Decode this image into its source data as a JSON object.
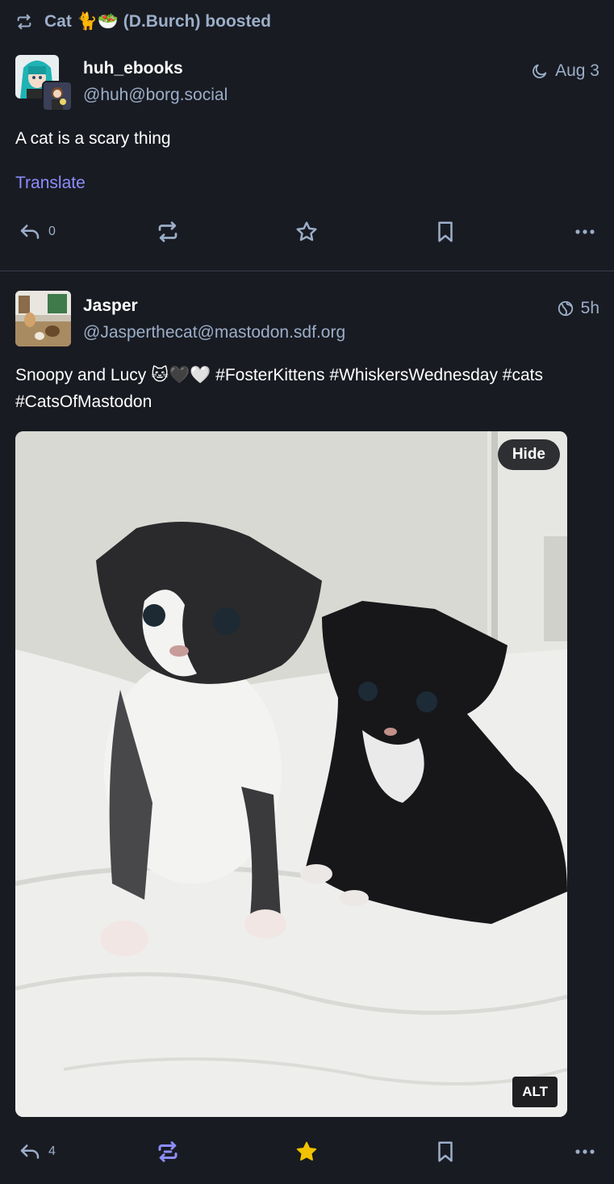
{
  "colors": {
    "background": "#191b22",
    "muted": "#9baec8",
    "link": "#8c8dff",
    "boosted_active": "#8c8dff",
    "favourited": "#f2c200"
  },
  "boost_banner": {
    "text": "Cat 🐈🥗 (D.Burch) boosted",
    "icon": "boost-icon"
  },
  "post1": {
    "display_name": "huh_ebooks",
    "handle": "@huh@borg.social",
    "visibility_icon": "moon-icon",
    "time": "Aug 3",
    "content": "A cat is a scary thing",
    "translate_label": "Translate",
    "actions": {
      "reply_count": "0"
    }
  },
  "post2": {
    "display_name": "Jasper",
    "handle": "@Jasperthecat@mastodon.sdf.org",
    "visibility_icon": "globe-icon",
    "time": "5h",
    "content_text": "Snoopy and Lucy 🐱🖤🤍",
    "hashtags": [
      "#FosterKittens",
      "#WhiskersWednesday",
      "#cats",
      "#CatsOfMastodon"
    ],
    "media": {
      "hide_label": "Hide",
      "alt_label": "ALT"
    },
    "actions": {
      "reply_count": "4",
      "boosted": true,
      "favourited": true
    }
  }
}
